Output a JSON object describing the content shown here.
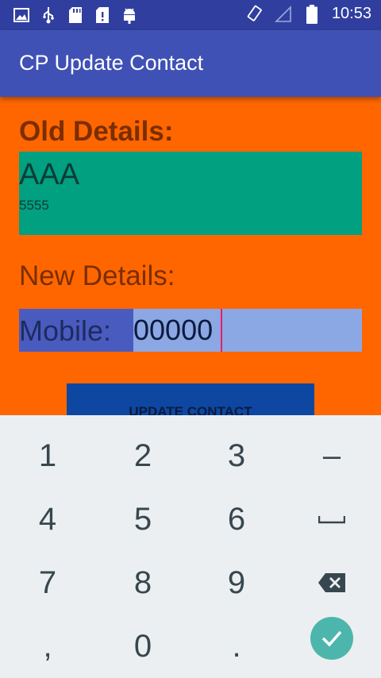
{
  "status_bar": {
    "time": "10:53",
    "icons_left": [
      "image-icon",
      "usb-icon",
      "sd-card-icon",
      "sd-card-icon",
      "android-debug-icon"
    ],
    "icons_right": [
      "rotate-icon",
      "signal-icon",
      "battery-icon"
    ]
  },
  "app_bar": {
    "title": "CP Update Contact"
  },
  "form": {
    "old_label": "Old Details:",
    "old_name": "AAA",
    "old_number": "5555",
    "new_label": "New Details:",
    "mobile_label": "Mobile:",
    "mobile_value": "00000",
    "update_button": "UPDATE CONTACT"
  },
  "keyboard": {
    "rows": [
      [
        "1",
        "2",
        "3",
        "–"
      ],
      [
        "4",
        "5",
        "6",
        "space"
      ],
      [
        "7",
        "8",
        "9",
        "backspace"
      ],
      [
        ",",
        "0",
        ".",
        "done"
      ]
    ],
    "accent_color": "#4DB6AC"
  },
  "colors": {
    "background": "#FF6600",
    "app_bar": "#3F51B5",
    "status_bar": "#303F9F",
    "old_box": "#00A080",
    "mobile_row": "#8BA8E5",
    "button": "#0D47A1"
  }
}
